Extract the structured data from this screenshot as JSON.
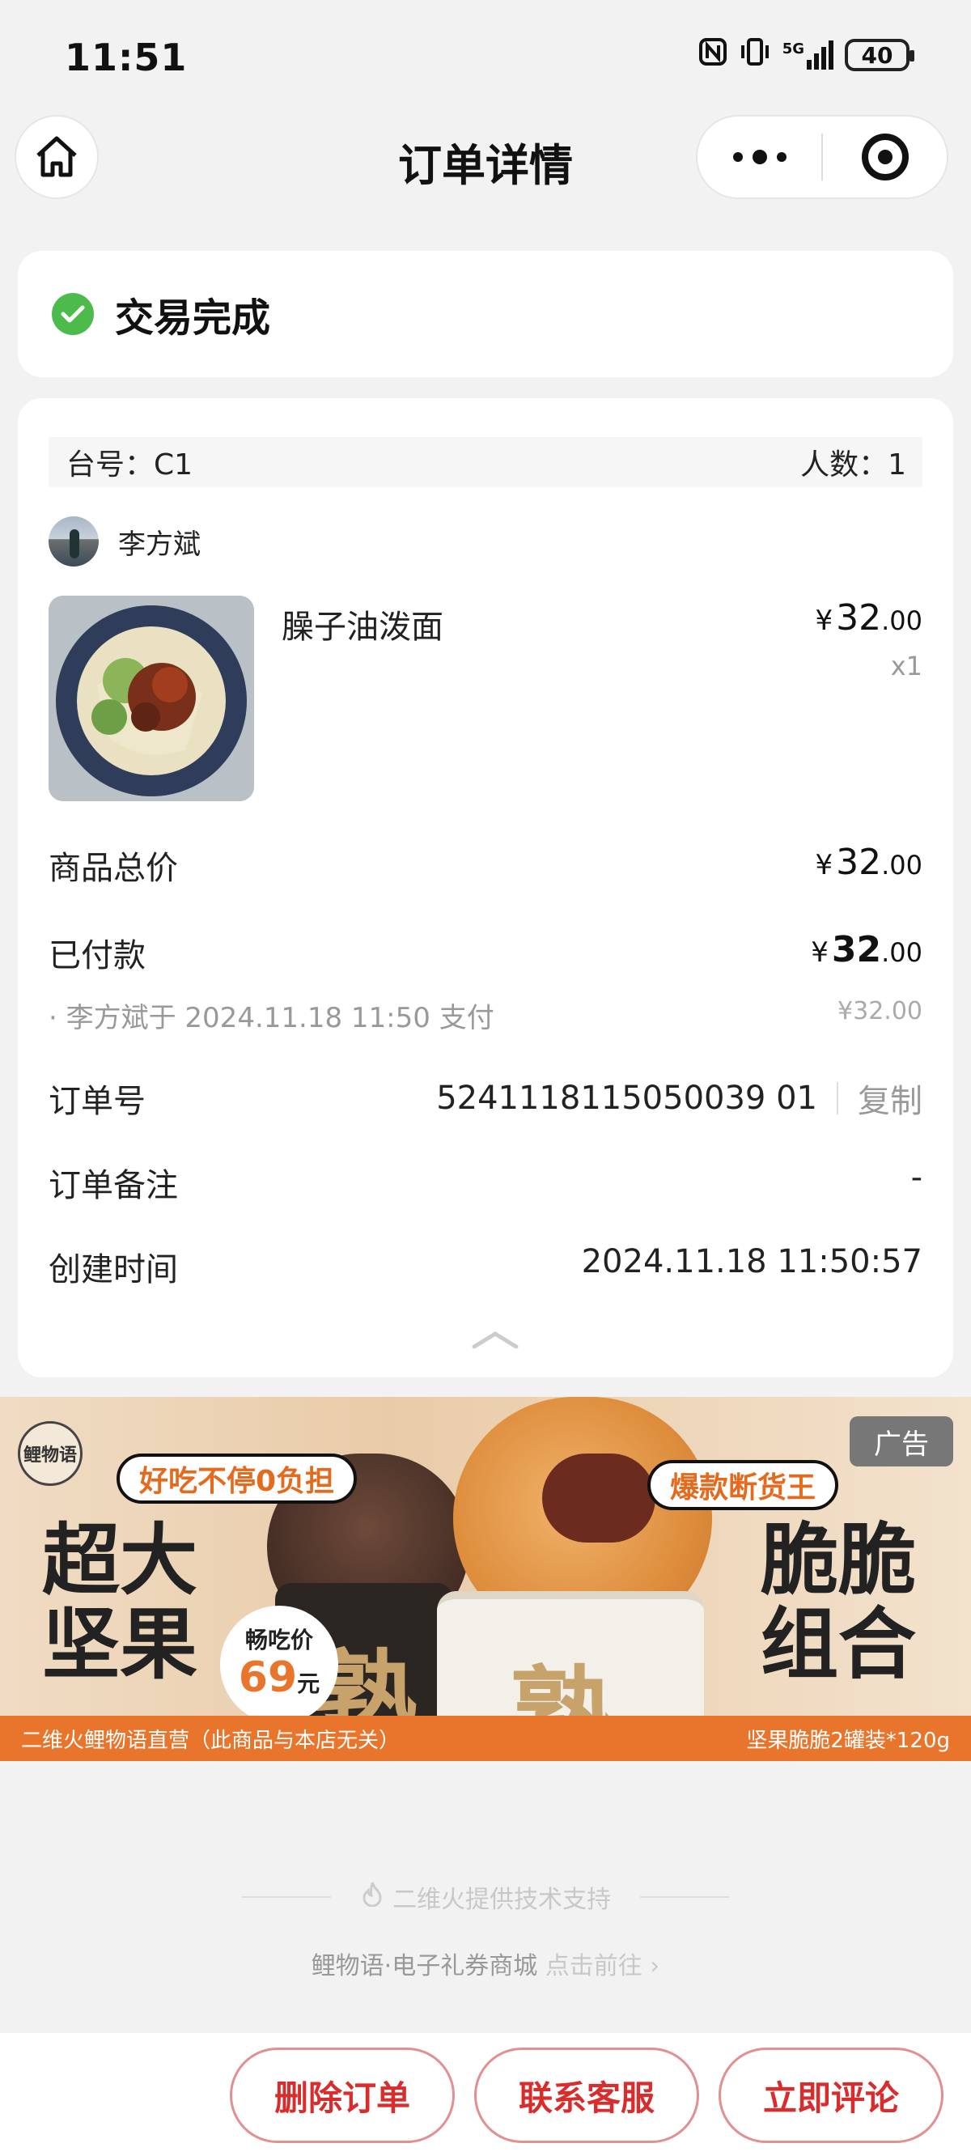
{
  "status_bar": {
    "time": "11:51",
    "signal": "5G",
    "battery": "40"
  },
  "nav": {
    "title": "订单详情"
  },
  "order_status": {
    "text": "交易完成"
  },
  "table": {
    "label": "台号：C1",
    "people": "人数：1"
  },
  "user": {
    "name": "李方斌"
  },
  "item": {
    "name": "臊子油泼面",
    "currency": "¥",
    "price_int": "32",
    "price_dec": ".00",
    "qty": "x1"
  },
  "summary": {
    "total_label": "商品总价",
    "total_int": "32",
    "total_dec": ".00",
    "paid_label": "已付款",
    "paid_int": "32",
    "paid_dec": ".00",
    "paid_note": "· 李方斌于 2024.11.18 11:50 支付",
    "paid_note_amount": "¥32.00",
    "order_no_label": "订单号",
    "order_no": "5241118115050039 01",
    "copy_label": "复制",
    "remark_label": "订单备注",
    "remark_value": "-",
    "created_label": "创建时间",
    "created_value": "2024.11.18 11:50:57"
  },
  "ad": {
    "tag": "广告",
    "logo": "鲤物语",
    "bubble_left": "好吃不停0负担",
    "bubble_right": "爆款断货王",
    "left_line1": "超大",
    "left_line2": "坚果",
    "right_line1": "脆脆",
    "right_line2": "组合",
    "price_label": "畅吃价",
    "price_value": "69",
    "price_unit": "元",
    "strip_left": "二维火鲤物语直营（此商品与本店无关）",
    "strip_right": "坚果脆脆2罐装*120g",
    "can_char": "熟"
  },
  "footer": {
    "support": "二维火提供技术支持",
    "mall": "鲤物语·电子礼券商城",
    "mall_link": "点击前往 ›"
  },
  "actions": {
    "delete": "删除订单",
    "contact": "联系客服",
    "review": "立即评论"
  },
  "colors": {
    "accent": "#d92d2d",
    "success": "#4cbb4c",
    "ad_orange": "#e8752b"
  }
}
